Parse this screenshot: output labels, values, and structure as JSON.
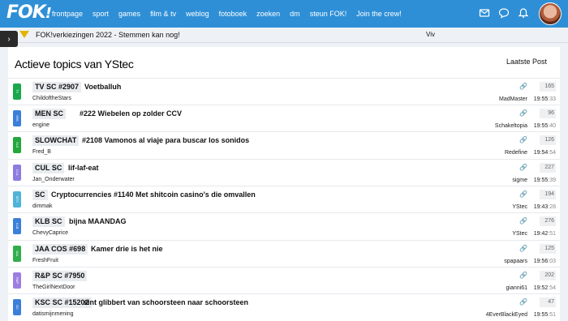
{
  "header": {
    "logo_text": "FOK",
    "logo_bang": "!",
    "nav": [
      "frontpage",
      "sport",
      "games",
      "film & tv",
      "weblog",
      "fotoboek",
      "zoeken",
      "dm",
      "steun FOK!",
      "Join the crew!"
    ],
    "icons": [
      "mail-icon",
      "chat-icon",
      "bell-icon"
    ]
  },
  "sidetab": {
    "icon": "›"
  },
  "ticker": {
    "badge": "TT",
    "message": "FOK!verkiezingen 2022 - Stemmen kan nog!",
    "right": "Viv"
  },
  "page": {
    "title": "Actieve topics van YStec",
    "column_header": "Laatste Post"
  },
  "topics": [
    {
      "badge": "TV",
      "color": "#19a84c",
      "forum": "TV SC #2907",
      "title": "Voetballuh",
      "starter": "ChildoftheStars",
      "count": "165",
      "poster": "MadMaster",
      "time_main": "19:55",
      "time_sec": ":33"
    },
    {
      "badge": "SPA",
      "color": "#3b7fd8",
      "forum": "MEN SC",
      "title": "#222 Wiebelen op zolder CCV",
      "starter": "engine",
      "count": "96",
      "poster": "Schakeltopia",
      "time_main": "19:55",
      "time_sec": ":40"
    },
    {
      "badge": "SLE",
      "color": "#23a83b",
      "forum": "SLOWCHAT",
      "title": "#2108 Vamonos al viaje para buscar los sonidos",
      "starter": "Fred_B",
      "count": "126",
      "poster": "Redefine",
      "time_main": "19:54",
      "time_sec": ":54"
    },
    {
      "badge": "CUL",
      "color": "#8e7be0",
      "forum": "CUL SC",
      "title": "lif-laf-eat",
      "starter": "Jan_Onderwater",
      "count": "227",
      "poster": "sigme",
      "time_main": "19:55",
      "time_sec": ":39"
    },
    {
      "badge": "BTC",
      "color": "#4fb4d9",
      "forum": "SC",
      "title": "Cryptocurrencies #1140 Met shitcoin casino's die omvallen",
      "starter": "dimmak",
      "count": "194",
      "poster": "YStec",
      "time_main": "19:43",
      "time_sec": ":28"
    },
    {
      "badge": "KLB",
      "color": "#3b7fd8",
      "forum": "KLB SC",
      "title": "bijna MAANDAG",
      "starter": "ChevyCaprice",
      "count": "276",
      "poster": "YStec",
      "time_main": "19:42",
      "time_sec": ":51"
    },
    {
      "badge": "JAA",
      "color": "#2fae4c",
      "forum": "JAA COS #698",
      "title": "Kamer drie is het nie",
      "starter": "FreshFruit",
      "count": "125",
      "poster": "spapaars",
      "time_main": "19:56",
      "time_sec": ":03"
    },
    {
      "badge": "R&P",
      "color": "#9d7ee0",
      "forum": "R&P SC #7950",
      "title": "",
      "starter": "TheGirlNextDoor",
      "count": "202",
      "poster": "gianni61",
      "time_main": "19:52",
      "time_sec": ":54"
    },
    {
      "badge": "GC",
      "color": "#3b7fd8",
      "forum": "KSC SC #15202",
      "title": "sint glibbert van schoorsteen naar schoorsteen",
      "starter": "datismijnmening",
      "count": "47",
      "poster": "4EverBlackEyed",
      "time_main": "19:55",
      "time_sec": ":51"
    }
  ]
}
